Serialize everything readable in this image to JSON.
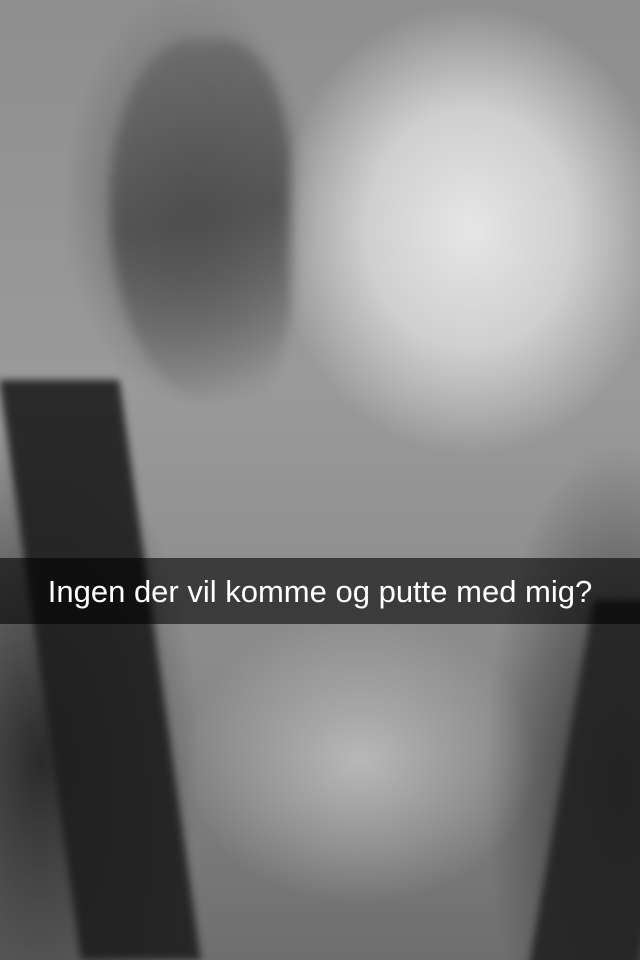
{
  "snap": {
    "caption": "Ingen der vil komme og putte med mig?",
    "photo": "grayscale selfie"
  },
  "colors": {
    "caption_bar": "#000000",
    "caption_text": "#ffffff"
  }
}
